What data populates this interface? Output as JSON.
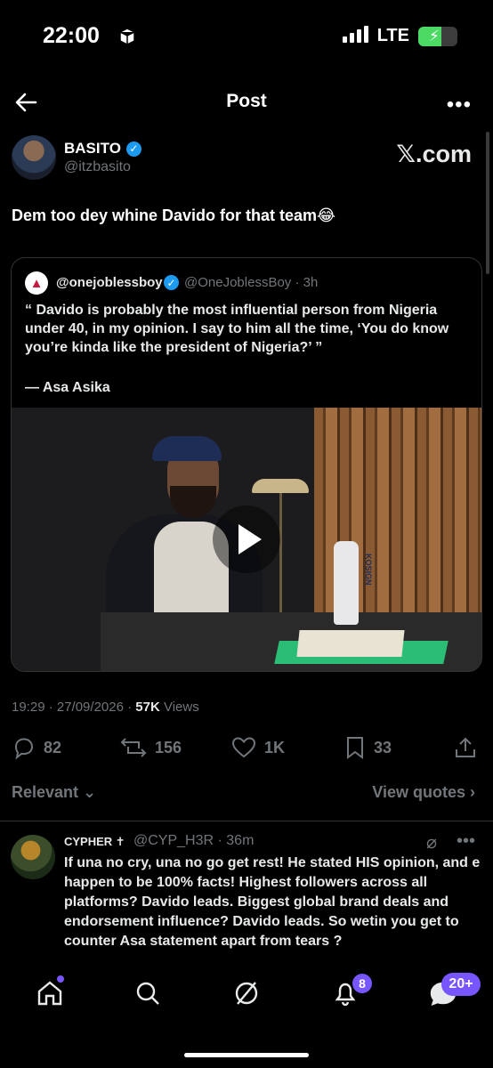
{
  "status_bar": {
    "time": "22:00",
    "network": "LTE"
  },
  "header": {
    "title": "Post"
  },
  "post": {
    "author_name": "BASITO",
    "author_handle": "@itzbasito",
    "watermark": "𝕏.com",
    "text": "Dem too dey whine Davido for that team😂",
    "timestamp": "19:29 · 27/09/2026 · ",
    "views_count": "57K",
    "views_label": " Views"
  },
  "quoted": {
    "name": "@onejoblessboy",
    "handle_time": "@OneJoblessBoy · 3h",
    "body": "“ Davido is probably the most influential person from Nigeria under 40, in my opinion. I say to him all the time, ‘You do know you’re kinda like the president of Nigeria?’ ”",
    "attribution": "— Asa Asika",
    "video_brand": "KOSIGN"
  },
  "actions": {
    "replies": "82",
    "reposts": "156",
    "likes": "1K",
    "bookmarks": "33"
  },
  "replies_bar": {
    "sort_label": "Relevant ⌄",
    "view_quotes_label": "View quotes ›"
  },
  "reply": {
    "name": "CYPHER ✝",
    "handle_time": "@CYP_H3R · 36m",
    "body": "If una no cry, una no go get rest!  He stated HIS opinion, and e happen to be 100% facts! Highest followers across all platforms? Davido leads. Biggest global brand deals and endorsement influence? Davido leads. So wetin you get to counter Asa statement apart from tears ?"
  },
  "navbar": {
    "notifications_badge": "8",
    "messages_badge": "20+"
  },
  "colors": {
    "accent": "#1d9bf0",
    "badge": "#7856ff",
    "muted": "#71767b"
  }
}
